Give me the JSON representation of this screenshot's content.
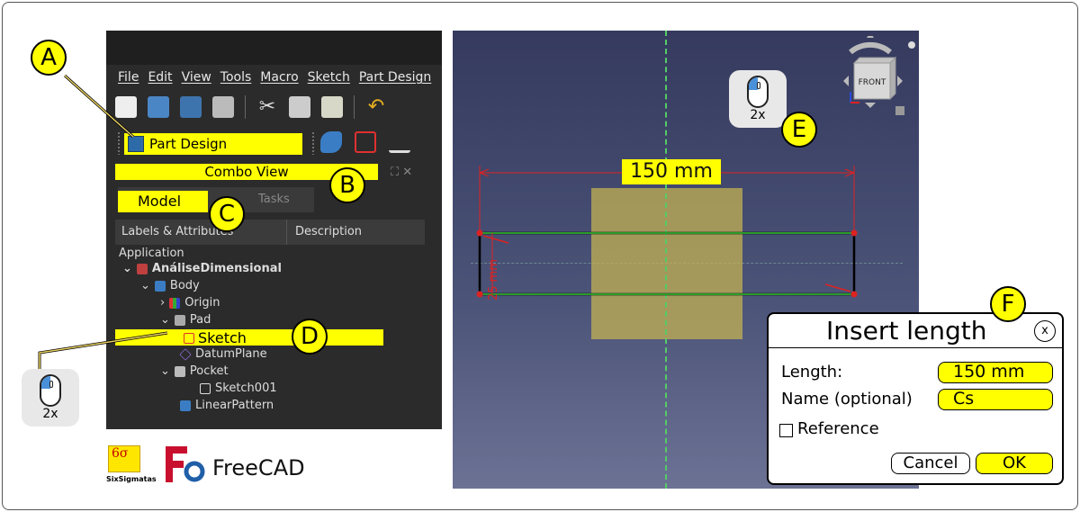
{
  "menu": [
    "File",
    "Edit",
    "View",
    "Tools",
    "Macro",
    "Sketch",
    "Part Design"
  ],
  "workbench": {
    "label": "Part Design"
  },
  "combo_view": {
    "title": "Combo View"
  },
  "tabs": {
    "model": "Model",
    "tasks": "Tasks"
  },
  "tree_header": {
    "labels": "Labels & Attributes",
    "description": "Description"
  },
  "tree": {
    "application": "Application",
    "document": "AnáliseDimensional",
    "body": "Body",
    "origin": "Origin",
    "pad": "Pad",
    "sketch": "Sketch",
    "datum_plane": "DatumPlane",
    "pocket": "Pocket",
    "sketch001": "Sketch001",
    "linear_pattern": "LinearPattern"
  },
  "callouts": {
    "a": "A",
    "b": "B",
    "c": "C",
    "d": "D",
    "e": "E",
    "f": "F"
  },
  "mouse": {
    "label_left": "2x",
    "label_view": "2x"
  },
  "logos": {
    "sixsigmatas": "SixSigmatas",
    "freecad": "FreeCAD"
  },
  "viewport": {
    "nav_cube_face": "FRONT",
    "dim_horizontal": "150 mm",
    "dim_vertical": "25 mm"
  },
  "dialog": {
    "title": "Insert length",
    "close": "x",
    "length_label": "Length:",
    "length_value": "150 mm",
    "name_label": "Name (optional)",
    "name_value": "Cs",
    "reference_label": "Reference",
    "reference_checked": false,
    "cancel": "Cancel",
    "ok": "OK"
  },
  "colors": {
    "highlight": "#ffff00",
    "panel": "#2b2b2b",
    "dimension": "#dd2222",
    "sketch_edge": "#2a8a2a"
  }
}
